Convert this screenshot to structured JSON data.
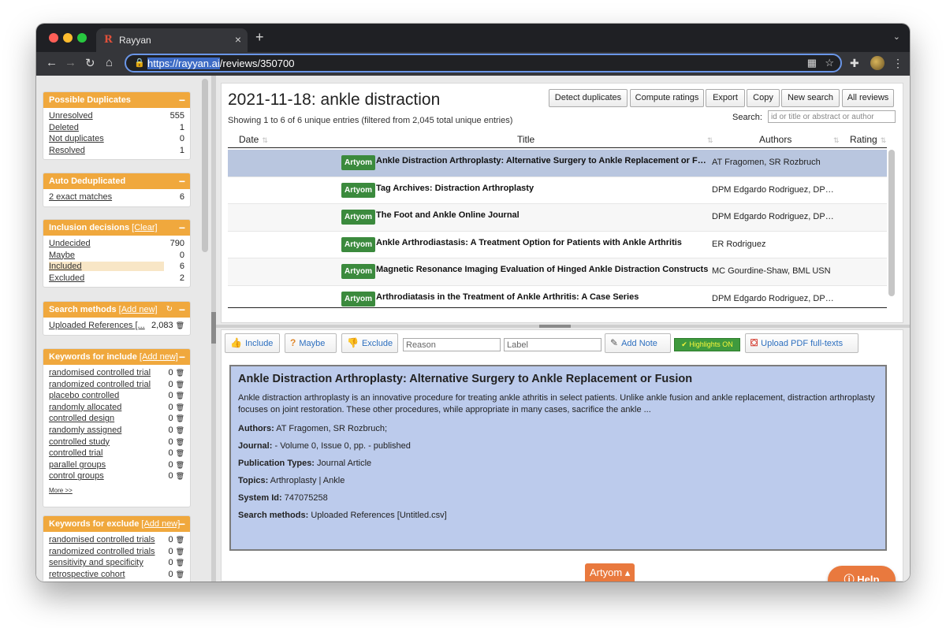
{
  "browser": {
    "tab_title": "Rayyan",
    "url_selected": "https://rayyan.ai",
    "url_rest": "/reviews/350700"
  },
  "sidebar": {
    "duplicates": {
      "title": "Possible Duplicates",
      "items": [
        {
          "label": "Unresolved",
          "count": "555"
        },
        {
          "label": "Deleted",
          "count": "1"
        },
        {
          "label": "Not duplicates",
          "count": "0"
        },
        {
          "label": "Resolved",
          "count": "1"
        }
      ]
    },
    "auto_dedup": {
      "title": "Auto Deduplicated",
      "items": [
        {
          "label": "2 exact matches",
          "count": "6"
        }
      ]
    },
    "inclusion": {
      "title": "Inclusion decisions",
      "clear_label": "[Clear]",
      "items": [
        {
          "label": "Undecided",
          "count": "790"
        },
        {
          "label": "Maybe",
          "count": "0"
        },
        {
          "label": "Included",
          "count": "6"
        },
        {
          "label": "Excluded",
          "count": "2"
        }
      ]
    },
    "search_methods": {
      "title": "Search methods",
      "add_label": "[Add new]",
      "items": [
        {
          "label": "Uploaded References [...",
          "count": "2,083"
        }
      ]
    },
    "kw_include": {
      "title": "Keywords for include",
      "add_label": "[Add new]",
      "items": [
        {
          "label": "randomised controlled trial",
          "count": "0"
        },
        {
          "label": "randomized controlled trial",
          "count": "0"
        },
        {
          "label": "placebo controlled",
          "count": "0"
        },
        {
          "label": "randomly allocated",
          "count": "0"
        },
        {
          "label": "controlled design",
          "count": "0"
        },
        {
          "label": "randomly assigned",
          "count": "0"
        },
        {
          "label": "controlled study",
          "count": "0"
        },
        {
          "label": "controlled trial",
          "count": "0"
        },
        {
          "label": "parallel groups",
          "count": "0"
        },
        {
          "label": "control groups",
          "count": "0"
        }
      ],
      "more_label": "More >>"
    },
    "kw_exclude": {
      "title": "Keywords for exclude",
      "add_label": "[Add new]",
      "items": [
        {
          "label": "randomised controlled trials",
          "count": "0"
        },
        {
          "label": "randomized controlled trials",
          "count": "0"
        },
        {
          "label": "sensitivity and specificity",
          "count": "0"
        },
        {
          "label": "retrospective cohort",
          "count": "0"
        }
      ]
    }
  },
  "results": {
    "title": "2021-11-18: ankle distraction",
    "showing": "Showing 1 to 6 of 6 unique entries (filtered from 2,045 total unique entries)",
    "buttons": {
      "detect": "Detect duplicates",
      "compute": "Compute ratings",
      "export": "Export",
      "copy": "Copy",
      "new_search": "New search",
      "all_reviews": "All reviews"
    },
    "search_label": "Search:",
    "search_placeholder": "id or title or abstract or author",
    "columns": {
      "date": "Date",
      "title": "Title",
      "authors": "Authors",
      "rating": "Rating"
    },
    "rows": [
      {
        "badge": "Artyom",
        "title": "Ankle Distraction Arthroplasty: Alternative Surgery to Ankle Replacement or Fusion",
        "authors": "AT Fragomen, SR Rozbruch"
      },
      {
        "badge": "Artyom",
        "title": "Tag Archives: Distraction Arthroplasty",
        "authors": "DPM Edgardo Rodriguez, DPM Stephen Kaplan"
      },
      {
        "badge": "Artyom",
        "title": "The Foot and Ankle Online Journal",
        "authors": "DPM Edgardo Rodriguez, DPM Stephen Kaplan"
      },
      {
        "badge": "Artyom",
        "title": "Ankle Arthrodiastasis: A Treatment Option for Patients with Ankle Arthritis",
        "authors": "ER Rodriguez"
      },
      {
        "badge": "Artyom",
        "title": "Magnetic Resonance Imaging Evaluation of Hinged Ankle Distraction Constructs",
        "authors": "MC Gourdine-Shaw, BML USN"
      },
      {
        "badge": "Artyom",
        "title": "Arthrodiatasis in the Treatment of Ankle Arthritis: A Case Series",
        "authors": "DPM Edgardo Rodriguez, DPM Stephen Kaplan"
      }
    ]
  },
  "detail": {
    "actions": {
      "include": "Include",
      "maybe": "Maybe",
      "exclude": "Exclude",
      "reason_placeholder": "Reason",
      "label_placeholder": "Label",
      "add_note": "Add Note",
      "highlights": "Highlights ON",
      "upload_pdf": "Upload PDF full-texts"
    },
    "title": "Ankle Distraction Arthroplasty: Alternative Surgery to Ankle Replacement or Fusion",
    "abstract": "Ankle distraction arthroplasty is an innovative procedure for treating ankle athritis in select patients. Unlike ankle fusion and ankle replacement, distraction arthroplasty focuses on joint restoration. These other procedures, while appropriate in many cases, sacrifice the ankle ...",
    "authors_label": "Authors:",
    "authors": "AT Fragomen, SR Rozbruch;",
    "journal_label": "Journal:",
    "journal": "- Volume 0, Issue 0, pp. - published",
    "pubtypes_label": "Publication Types:",
    "pubtypes": "Journal Article",
    "topics_label": "Topics:",
    "topics": "Arthroplasty | Ankle",
    "sysid_label": "System Id:",
    "sysid": "747075258",
    "methods_label": "Search methods:",
    "methods": "Uploaded References [Untitled.csv]"
  },
  "help_label": "Help",
  "user_menu_label": "Artyom",
  "colors": {
    "accent": "#f0a83d",
    "badge": "#3b8a3d",
    "help": "#e9793e",
    "abstract_bg": "#bccbec"
  }
}
